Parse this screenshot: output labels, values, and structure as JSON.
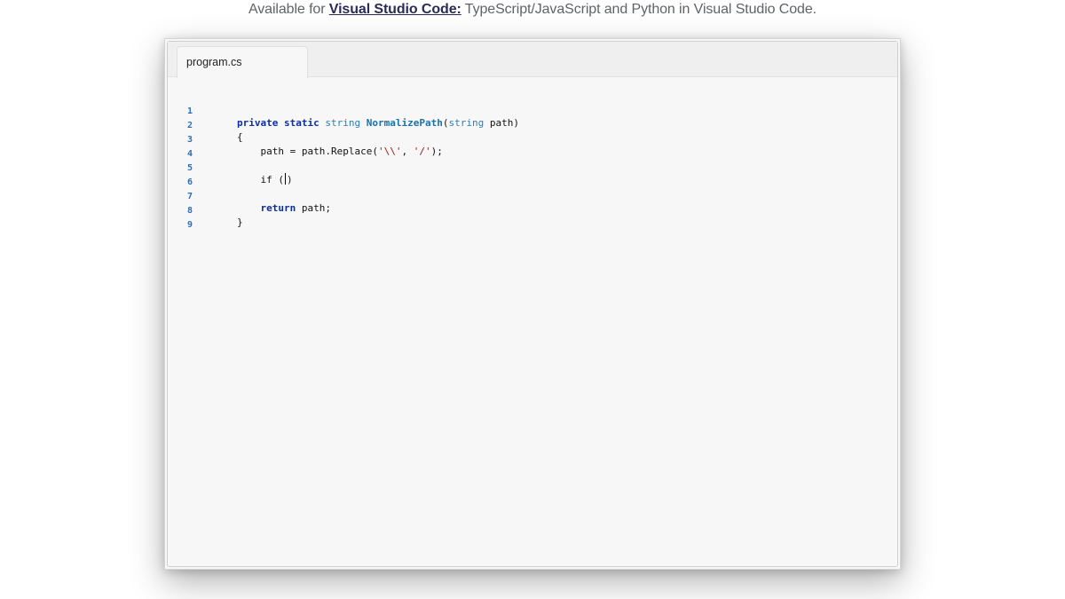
{
  "caption": {
    "prefix": "Available for ",
    "link": "Visual Studio Code:",
    "suffix": " TypeScript/JavaScript and Python in Visual Studio Code."
  },
  "editor": {
    "tab_label": "program.cs",
    "lines": [
      {
        "number": "1",
        "tokens": {
          "kw1": "private",
          "sp1": " ",
          "kw2": "static",
          "sp2": " ",
          "ty1": "string",
          "sp3": " ",
          "fn": "NormalizePath",
          "p1": "(",
          "ty2": "string",
          "rest": " path)"
        }
      },
      {
        "number": "2",
        "text": "{"
      },
      {
        "number": "3",
        "tokens": {
          "a": "    path = path.Replace(",
          "s1": "'\\\\'",
          "b": ", ",
          "s2": "'/'",
          "c": ");"
        }
      },
      {
        "number": "4",
        "text": ""
      },
      {
        "number": "5",
        "tokens": {
          "a": "    if (",
          "b": ")"
        }
      },
      {
        "number": "6",
        "text": ""
      },
      {
        "number": "7",
        "tokens": {
          "indent": "    ",
          "kw": "return",
          "rest": " path;"
        }
      },
      {
        "number": "8",
        "text": "}"
      },
      {
        "number": "9",
        "text": ""
      }
    ]
  }
}
